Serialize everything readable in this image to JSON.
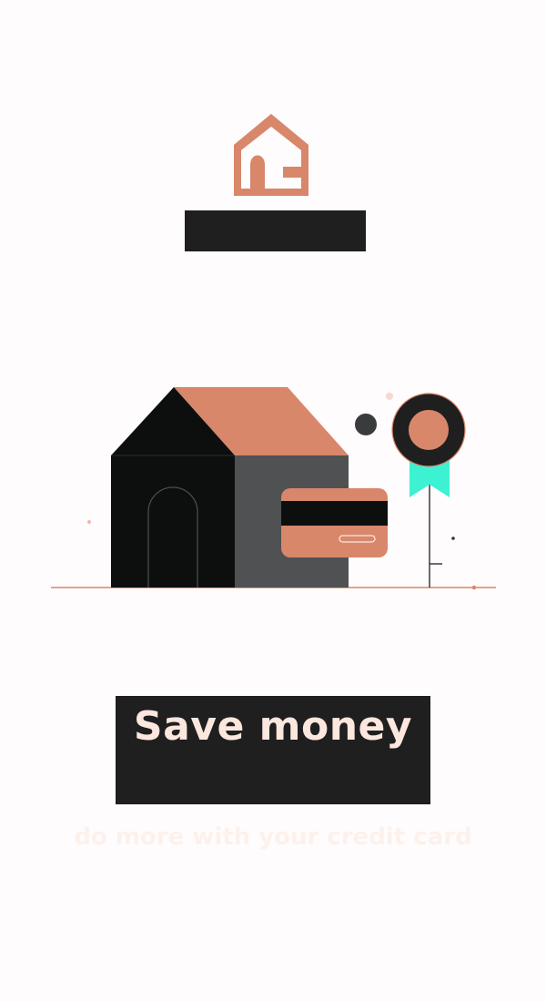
{
  "screen": {
    "headline": "Save money",
    "subtitle": "do more with your credit card"
  },
  "colors": {
    "accent": "#d8876b",
    "dark": "#1f1f20",
    "charcoal": "#0d0f0e",
    "wall_grey": "#4f5153",
    "mint": "#3df2d2",
    "headline_text": "#fbe7de",
    "subtitle_text": "#fdf1ec",
    "background": "#fefcfd"
  },
  "icons": {
    "logo": "home-logo-icon",
    "house": "house-illustration",
    "card": "credit-card-illustration",
    "badge": "award-ribbon-icon"
  }
}
